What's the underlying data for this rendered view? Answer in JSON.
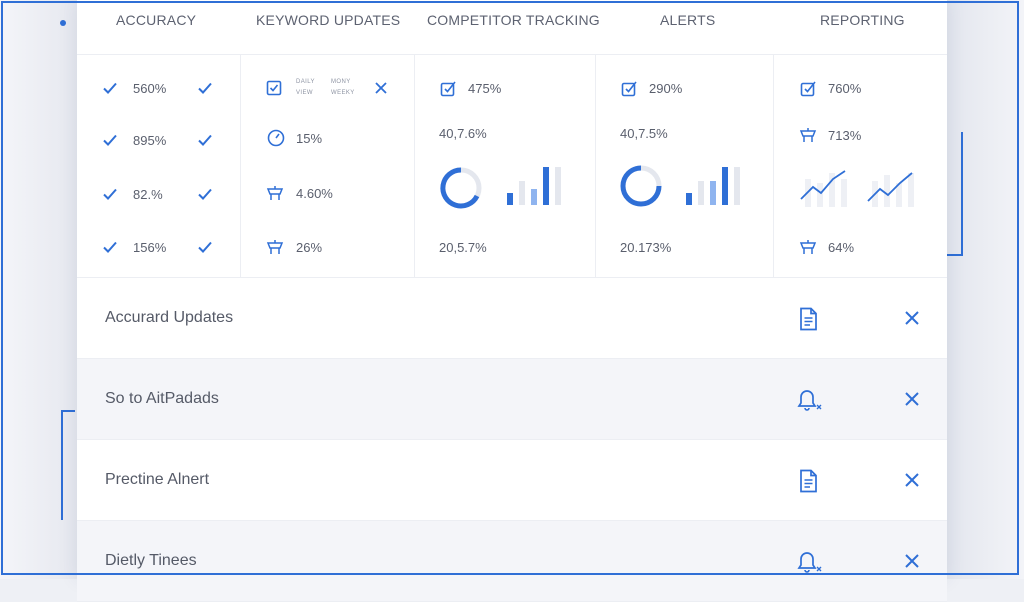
{
  "tabs": [
    "ACCURACY",
    "KEYWORD UPDATES",
    "COMPETITOR TRACKING",
    "ALERTS",
    "REPORTING"
  ],
  "accuracy": {
    "values": [
      "560%",
      "895%",
      "82.%",
      "156%"
    ]
  },
  "keyword_updates": {
    "tiny_labels": [
      "DAILY",
      "MONY",
      "VIEW",
      "WEEKY"
    ],
    "values": [
      "15%",
      "4.60%",
      "26%"
    ]
  },
  "competitor_tracking": {
    "top": "475%",
    "mid": "40,7.6%",
    "bottom": "20,5.7%"
  },
  "alerts_col": {
    "top": "290%",
    "mid": "40,7.5%",
    "bottom": "20.173%"
  },
  "reporting": {
    "top": "760%",
    "mid": "713%",
    "bottom": "64%"
  },
  "rows": [
    {
      "label": "Accurard Updates",
      "icon": "document-icon"
    },
    {
      "label": "So to AitPadads",
      "icon": "bell-icon"
    },
    {
      "label": "Prectine Alnert",
      "icon": "document-icon"
    },
    {
      "label": "Dietly Tinees",
      "icon": "bell-icon"
    }
  ],
  "colors": {
    "accent": "#2f6fd6",
    "light_accent": "#8fb4ef",
    "muted": "#e4e7ee"
  }
}
